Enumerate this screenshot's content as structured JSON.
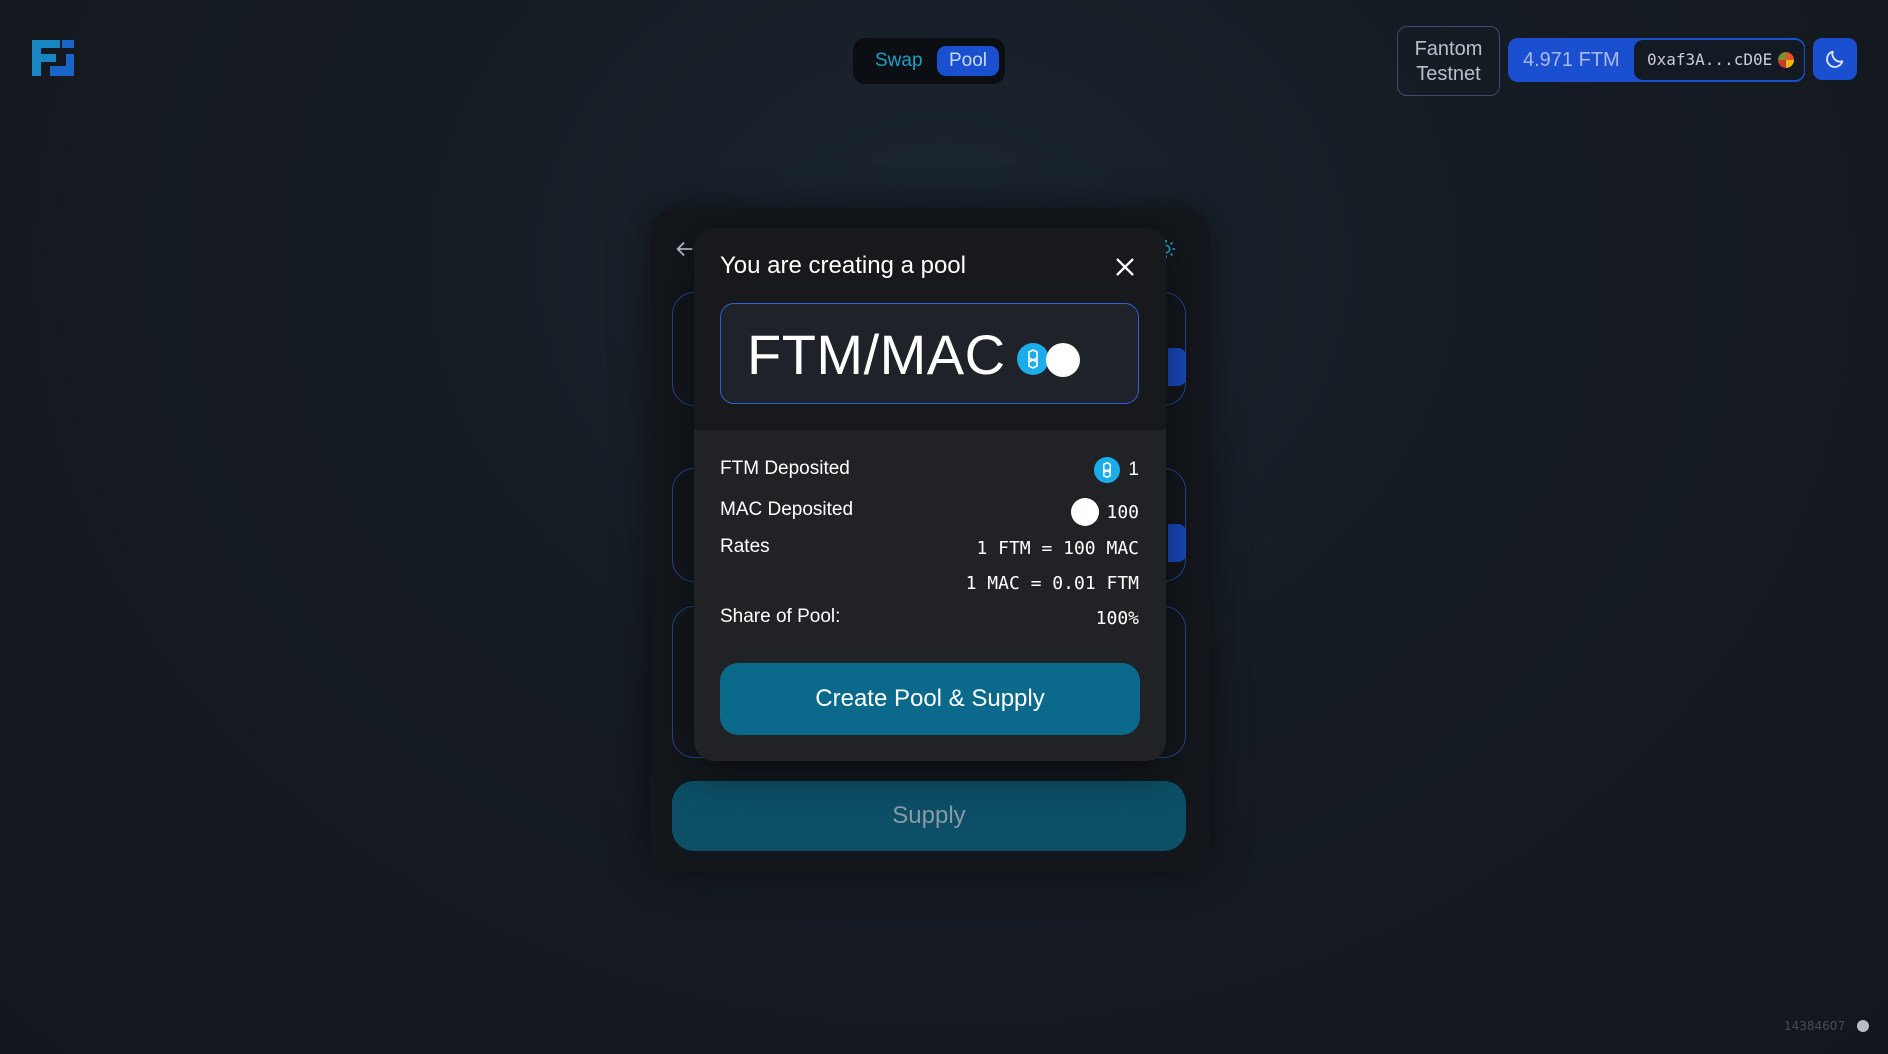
{
  "nav": {
    "swap_label": "Swap",
    "pool_label": "Pool"
  },
  "header": {
    "network_line1": "Fantom",
    "network_line2": "Testnet",
    "balance": "4.971 FTM",
    "address": "0xaf3A...cD0E"
  },
  "background_card": {
    "supply_label": "Supply"
  },
  "modal": {
    "title": "You are creating a pool",
    "pair": "FTM/MAC",
    "ftm_deposited_label": "FTM Deposited",
    "ftm_deposited_value": "1",
    "mac_deposited_label": "MAC Deposited",
    "mac_deposited_value": "100",
    "rates_label": "Rates",
    "rate1": "1 FTM = 100 MAC",
    "rate2": "1 MAC = 0.01 FTM",
    "share_label": "Share of Pool:",
    "share_value": "100%",
    "create_button_label": "Create Pool & Supply"
  },
  "footer": {
    "block_number": "14384607"
  },
  "colors": {
    "accent_blue": "#1a4fcf",
    "teal_button": "#0b6a8b",
    "ftm_token": "#1bade9"
  },
  "icons": [
    "app-logo-icon",
    "back-arrow-icon",
    "gear-icon",
    "close-icon",
    "ftm-token-icon",
    "mac-token-icon",
    "moon-icon",
    "wallet-avatar-icon",
    "status-dot-icon"
  ]
}
